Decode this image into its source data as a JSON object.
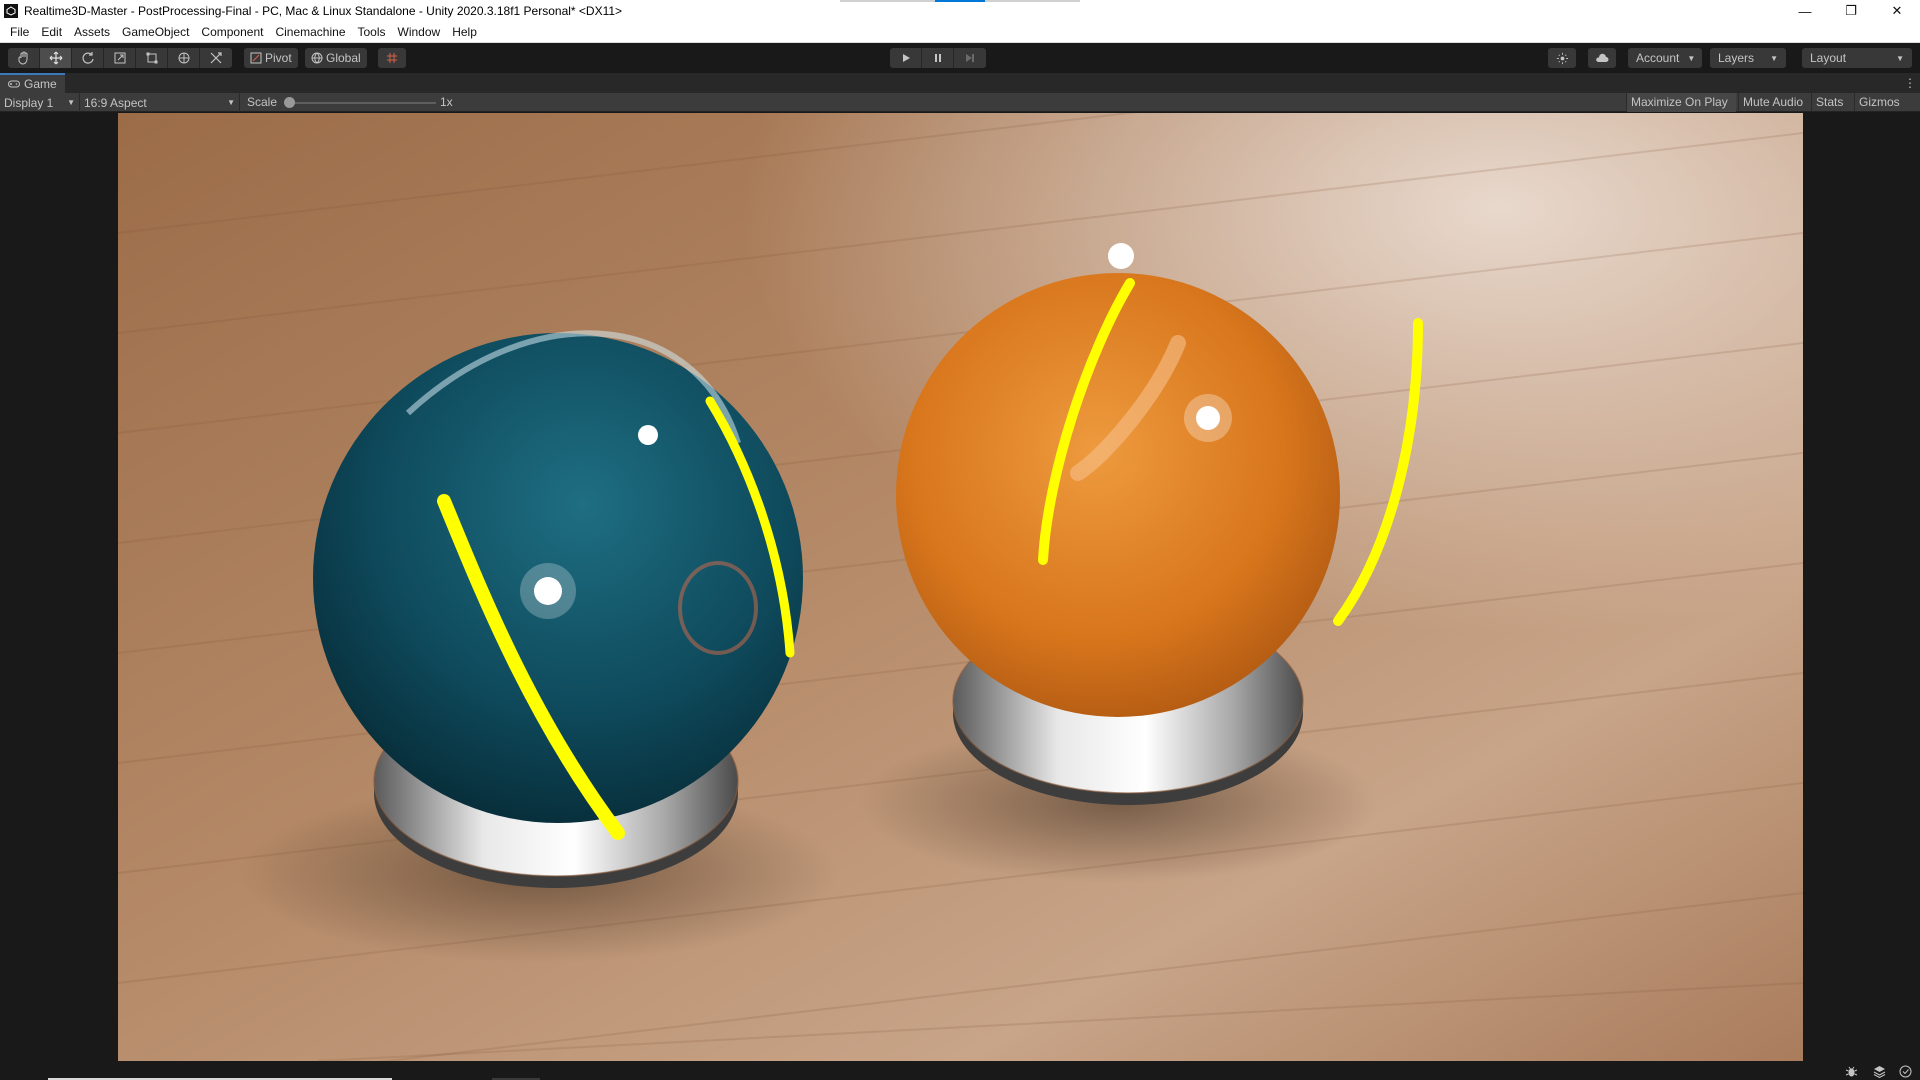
{
  "window": {
    "title": "Realtime3D-Master - PostProcessing-Final - PC, Mac & Linux Standalone - Unity 2020.3.18f1 Personal* <DX11>",
    "controls": [
      "minimize-icon",
      "restore-icon",
      "close-icon"
    ]
  },
  "menu": {
    "items": [
      "File",
      "Edit",
      "Assets",
      "GameObject",
      "Component",
      "Cinemachine",
      "Tools",
      "Window",
      "Help"
    ]
  },
  "toolbar": {
    "transform_tools": [
      "hand-tool-icon",
      "move-tool-icon",
      "rotate-tool-icon",
      "scale-tool-icon",
      "rect-tool-icon",
      "transform-tool-icon",
      "custom-tool-icon"
    ],
    "active_tool": "move-tool-icon",
    "pivot_label": "Pivot",
    "global_label": "Global",
    "account_label": "Account",
    "layers_label": "Layers",
    "layout_label": "Layout"
  },
  "game_tab": {
    "label": "Game"
  },
  "game_toolbar": {
    "display": "Display 1",
    "aspect": "16:9 Aspect",
    "scale_label": "Scale",
    "scale_value": "1x",
    "maximize_on_play": "Maximize On Play",
    "mute_audio": "Mute Audio",
    "stats": "Stats",
    "gizmos": "Gizmos"
  },
  "scene": {
    "objects": [
      "teal-glass-ball-on-chrome-stand",
      "orange-ball-on-chrome-stand"
    ],
    "colors": {
      "wood": "#b08564",
      "teal": "#0e4a5c",
      "orange": "#d8761c",
      "stripe": "#ffff00",
      "chrome": "#cfcfcf"
    }
  }
}
